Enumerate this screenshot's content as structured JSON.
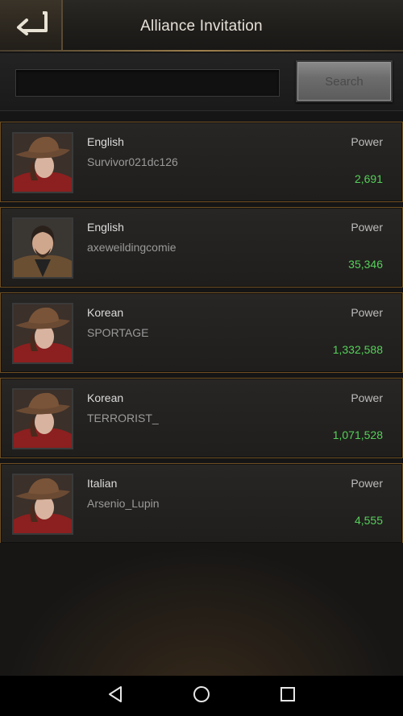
{
  "header": {
    "title": "Alliance Invitation",
    "back_icon": "back-arrow-icon"
  },
  "search": {
    "value": "",
    "placeholder": "",
    "button_label": "Search"
  },
  "players": [
    {
      "language": "English",
      "name": "Survivor021dc126",
      "power_label": "Power",
      "power": "2,691",
      "avatar": "cowboy-hat-survivor-avatar"
    },
    {
      "language": "English",
      "name": "axeweildingcomie",
      "power_label": "Power",
      "power": "35,346",
      "avatar": "bearded-survivor-avatar"
    },
    {
      "language": "Korean",
      "name": "SPORTAGE",
      "power_label": "Power",
      "power": "1,332,588",
      "avatar": "cowboy-hat-survivor-avatar"
    },
    {
      "language": "Korean",
      "name": "TERRORIST_",
      "power_label": "Power",
      "power": "1,071,528",
      "avatar": "cowboy-hat-survivor-avatar"
    },
    {
      "language": "Italian",
      "name": "Arsenio_Lupin",
      "power_label": "Power",
      "power": "4,555",
      "avatar": "cowboy-hat-survivor-avatar"
    }
  ],
  "nav": {
    "back_icon": "triangle-back-icon",
    "home_icon": "circle-home-icon",
    "recents_icon": "square-recents-icon"
  },
  "colors": {
    "power_value": "#55d05a",
    "card_border": "#6e4e22",
    "accent_gold": "#c8a05a"
  }
}
